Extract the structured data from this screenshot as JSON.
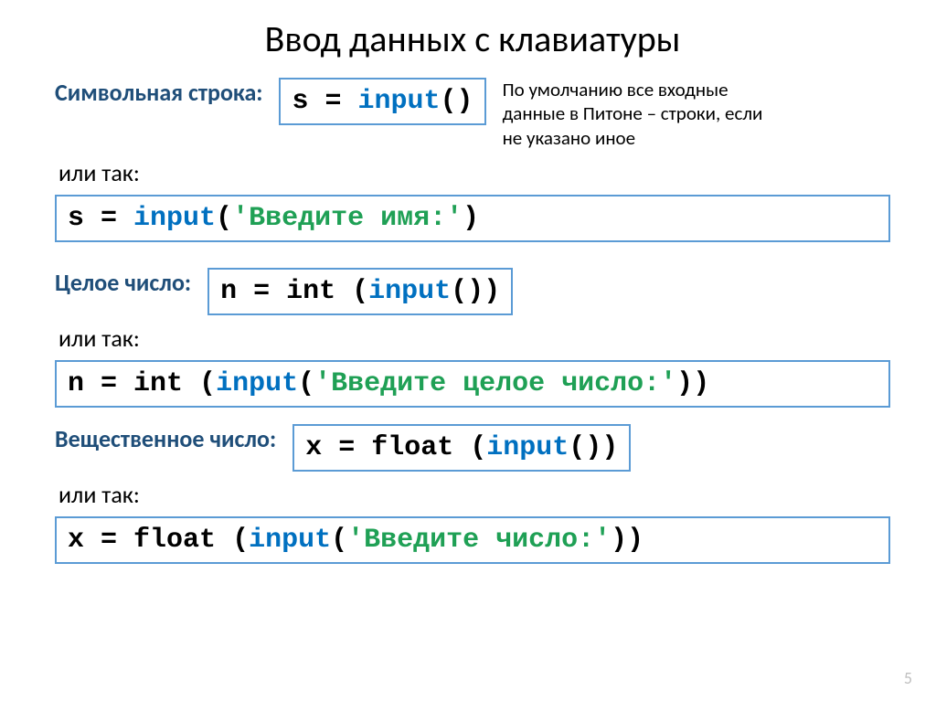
{
  "title": "Ввод данных с клавиатуры",
  "sections": {
    "string": {
      "label": "Символьная строка:",
      "note": "По умолчанию все входные данные в Питоне – строки, если не указано иное",
      "orLabel": "или так:",
      "code1": {
        "var": "s",
        "eq": " = ",
        "fn": "input",
        "args_open": "(",
        "args_close": ")"
      },
      "code2": {
        "var": "s",
        "eq": " = ",
        "fn": "input",
        "args_open": "(",
        "str": "'Введите имя:'",
        "args_close": ")"
      }
    },
    "int": {
      "label": "Целое число:",
      "orLabel": "или так:",
      "code1": {
        "var": "n",
        "eq": " = ",
        "outer_fn": "int ",
        "open1": "(",
        "inner_fn": "input",
        "open2": "(",
        "close2": ")",
        "close1": ")"
      },
      "code2": {
        "var": "n",
        "eq": " = ",
        "outer_fn": "int ",
        "open1": "(",
        "inner_fn": "input",
        "open2": "(",
        "str": "'Введите целое число:'",
        "close2": ")",
        "close1": ")"
      }
    },
    "float": {
      "label": "Вещественное число:",
      "orLabel": "или так:",
      "code1": {
        "var": "x",
        "eq": " = ",
        "outer_fn": "float ",
        "open1": "(",
        "inner_fn": "input",
        "open2": "(",
        "close2": ")",
        "close1": ")"
      },
      "code2": {
        "var": "x",
        "eq": " = ",
        "outer_fn": "float ",
        "open1": "(",
        "inner_fn": "input",
        "open2": "(",
        "str": "'Введите число:'",
        "close2": ")",
        "close1": ")"
      }
    }
  },
  "pageNumber": "5"
}
